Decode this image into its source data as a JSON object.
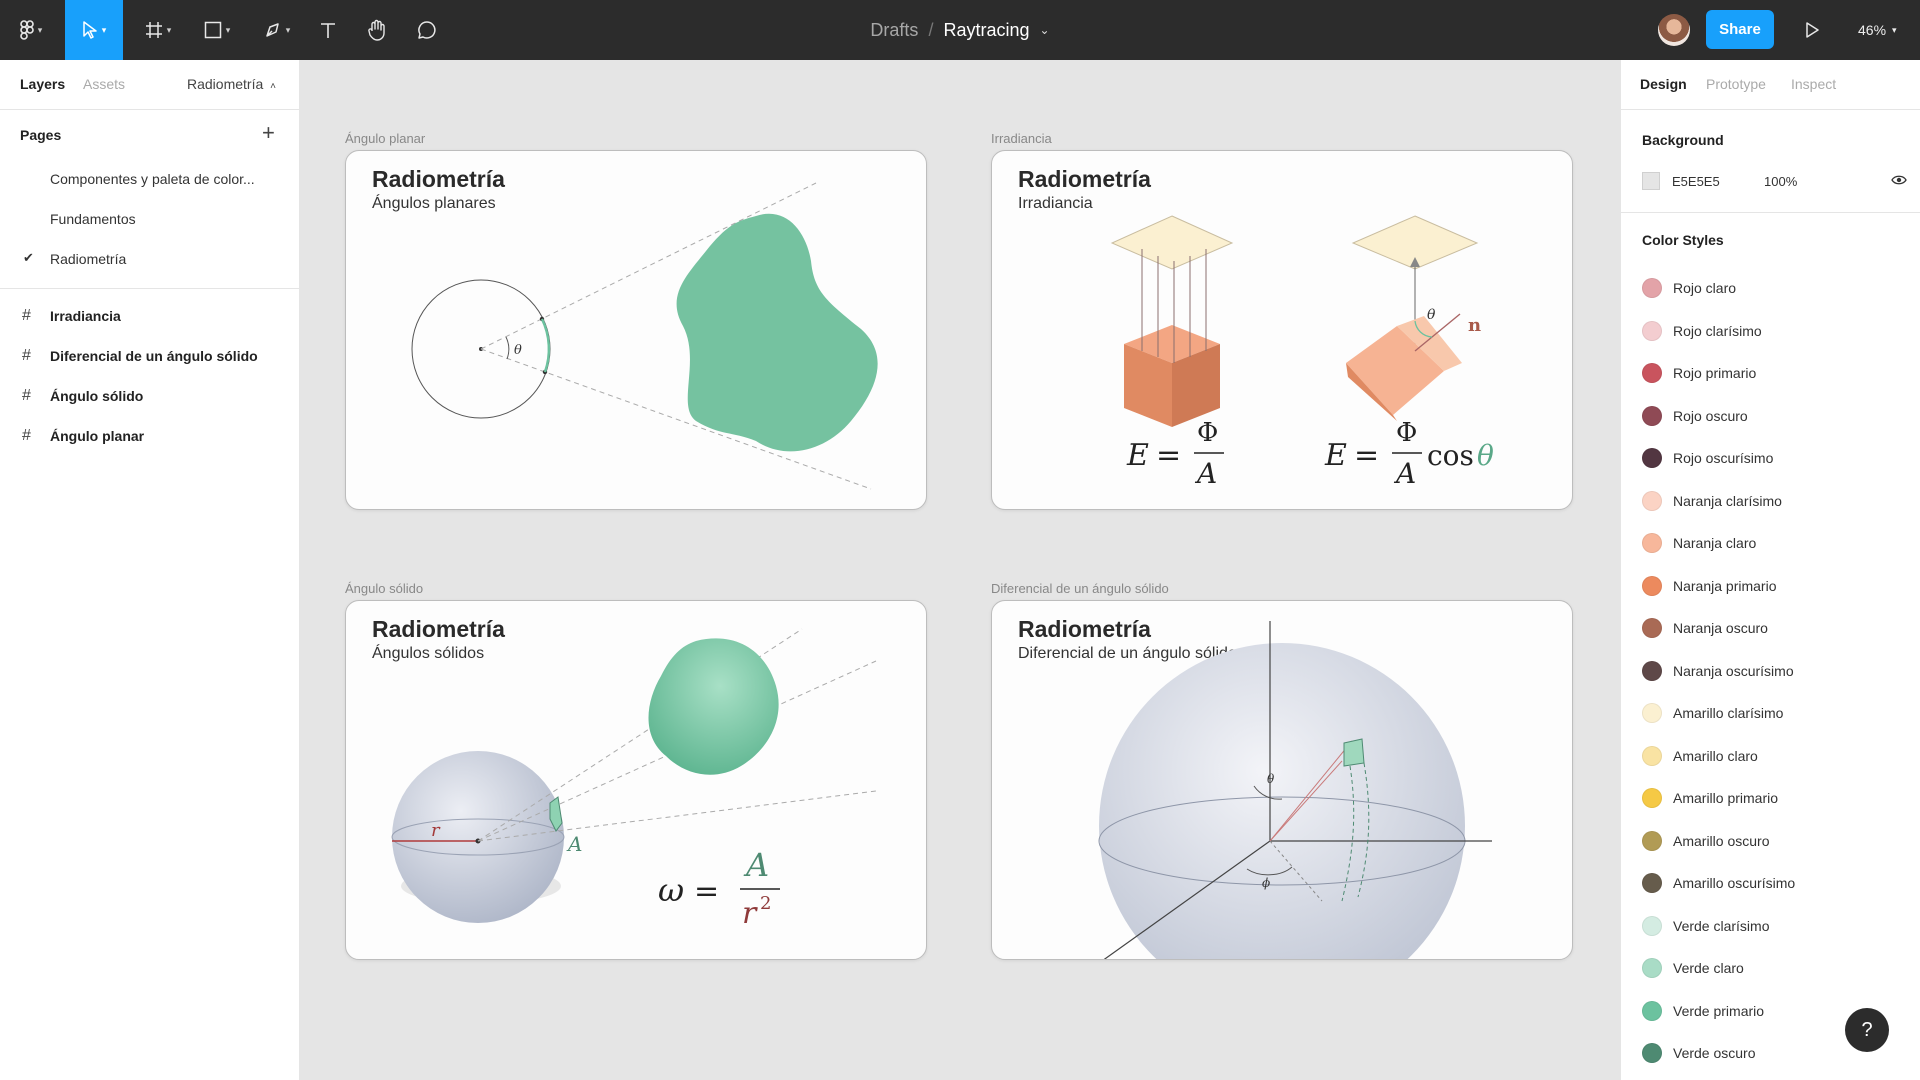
{
  "toolbar": {
    "breadcrumb": "Drafts",
    "separator": "/",
    "file_title": "Raytracing",
    "share_label": "Share",
    "zoom": "46%"
  },
  "left_panel": {
    "tabs": {
      "layers": "Layers",
      "assets": "Assets",
      "page_selector": "Radiometría"
    },
    "pages_heading": "Pages",
    "add_symbol": "+",
    "pages": [
      {
        "label": "Componentes y paleta de color..."
      },
      {
        "label": "Fundamentos"
      },
      {
        "label": "Radiometría",
        "selected": true
      }
    ],
    "frames": [
      {
        "label": "Irradiancia"
      },
      {
        "label": "Diferencial de un ángulo sólido"
      },
      {
        "label": "Ángulo sólido"
      },
      {
        "label": "Ángulo planar"
      }
    ]
  },
  "canvas": {
    "frames": [
      {
        "label": "Ángulo planar",
        "title": "Radiometría",
        "subtitle": "Ángulos planares"
      },
      {
        "label": "Irradiancia",
        "title": "Radiometría",
        "subtitle": "Irradiancia"
      },
      {
        "label": "Ángulo sólido",
        "title": "Radiometría",
        "subtitle": "Ángulos sólidos"
      },
      {
        "label": "Diferencial de un ángulo sólido",
        "title": "Radiometría",
        "subtitle": "Diferencial de un ángulo sólido"
      }
    ],
    "math": {
      "theta": "θ",
      "E": "E",
      "equals": "=",
      "Phi": "Φ",
      "A": "A",
      "cos": "cos",
      "n": "n",
      "r": "r",
      "omega": "ω",
      "r_squared": "r",
      "exp": "2",
      "phi": "ϕ"
    }
  },
  "right_panel": {
    "tabs": {
      "design": "Design",
      "prototype": "Prototype",
      "inspect": "Inspect"
    },
    "background": {
      "title": "Background",
      "hex": "E5E5E5",
      "opacity": "100%",
      "color": "#e5e5e5"
    },
    "color_styles_title": "Color Styles",
    "color_styles": [
      {
        "name": "Rojo claro",
        "color": "#e3a3a8"
      },
      {
        "name": "Rojo clarísimo",
        "color": "#f3cdd0"
      },
      {
        "name": "Rojo primario",
        "color": "#c9545e"
      },
      {
        "name": "Rojo oscuro",
        "color": "#8f4a55"
      },
      {
        "name": "Rojo oscurísimo",
        "color": "#523641"
      },
      {
        "name": "Naranja clarísimo",
        "color": "#fbd3c4"
      },
      {
        "name": "Naranja claro",
        "color": "#f7b79b"
      },
      {
        "name": "Naranja primario",
        "color": "#ec8a5e"
      },
      {
        "name": "Naranja oscuro",
        "color": "#a96a55"
      },
      {
        "name": "Naranja oscurísimo",
        "color": "#5e4848"
      },
      {
        "name": "Amarillo clarísimo",
        "color": "#fbf0d1"
      },
      {
        "name": "Amarillo claro",
        "color": "#f9e3a3"
      },
      {
        "name": "Amarillo primario",
        "color": "#f5c945"
      },
      {
        "name": "Amarillo oscuro",
        "color": "#b19b55"
      },
      {
        "name": "Amarillo oscurísimo",
        "color": "#665c4c"
      },
      {
        "name": "Verde clarísimo",
        "color": "#d4ece2"
      },
      {
        "name": "Verde claro",
        "color": "#a9dcc6"
      },
      {
        "name": "Verde primario",
        "color": "#6cc29f"
      },
      {
        "name": "Verde oscuro",
        "color": "#4e8a72"
      }
    ]
  },
  "help_symbol": "?"
}
